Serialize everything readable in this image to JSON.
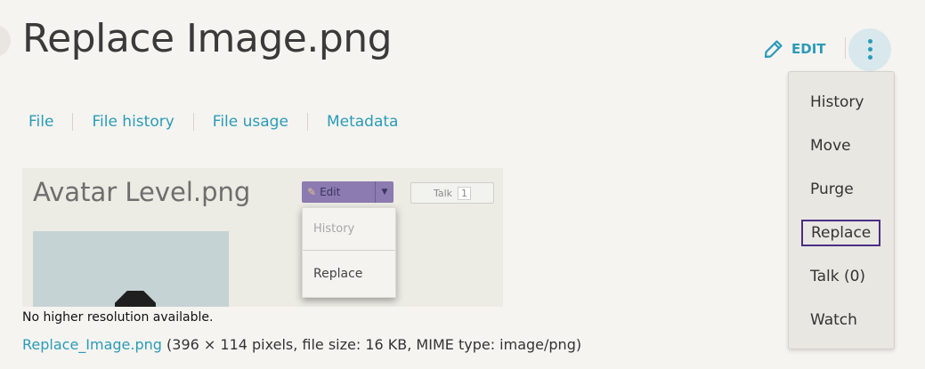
{
  "page": {
    "title": "Replace Image.png"
  },
  "actions": {
    "edit_label": "EDIT",
    "edit_icon": "pencil-icon",
    "more_icon": "vertical-dots-icon"
  },
  "tabs": [
    {
      "label": "File"
    },
    {
      "label": "File history"
    },
    {
      "label": "File usage"
    },
    {
      "label": "Metadata"
    }
  ],
  "preview": {
    "title": "Avatar Level.png",
    "edit_label": "Edit",
    "talk_label": "Talk",
    "talk_count": "1",
    "menu_items": [
      "History",
      "Replace"
    ]
  },
  "caption": {
    "resolution_note": "No higher resolution available.",
    "file_link": "Replace_Image.png",
    "file_info": "(396 × 114 pixels, file size: 16 KB, MIME type: image/png)"
  },
  "menu": {
    "items": [
      "History",
      "Move",
      "Purge",
      "Replace",
      "Talk (0)",
      "Watch"
    ],
    "highlighted": "Replace"
  },
  "colors": {
    "accent": "#2a9bb8",
    "highlight_border": "#4b2e83",
    "background": "#f6f4f0"
  }
}
